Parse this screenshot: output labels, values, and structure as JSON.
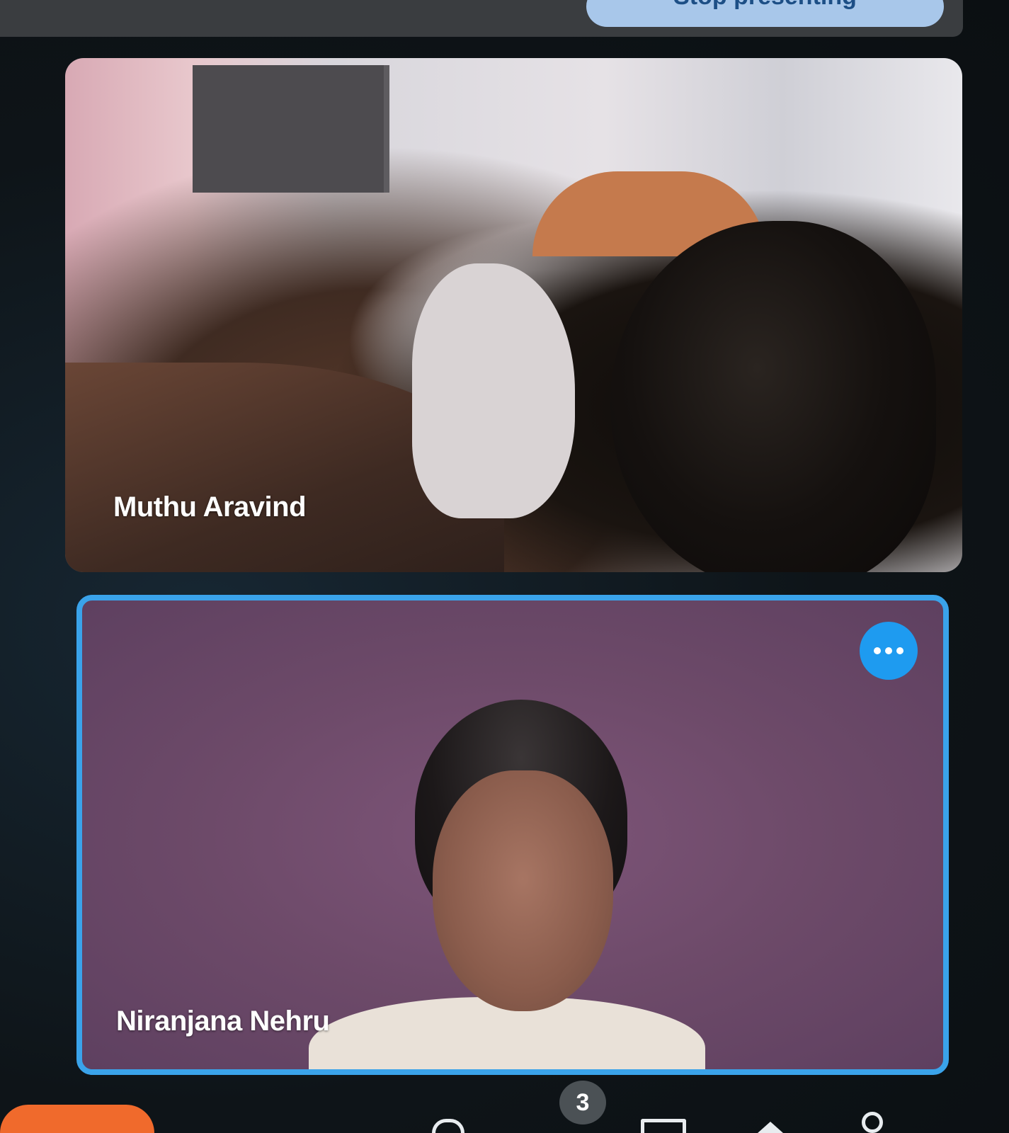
{
  "header": {
    "pill_label": "Stop presenting"
  },
  "participants": [
    {
      "name": "Muthu Aravind"
    },
    {
      "name": "Niranjana Nehru"
    }
  ],
  "tile_menu": {
    "icon": "more-horizontal-icon"
  },
  "bottom_bar": {
    "participant_count": "3",
    "icons": [
      "chat-icon",
      "present-icon",
      "raise-hand-icon",
      "people-icon"
    ]
  },
  "colors": {
    "active_speaker_border": "#3aa3ea",
    "menu_button": "#1e9bf0",
    "leave_button": "#f06a2c",
    "pill_background": "#a8c7ea"
  }
}
